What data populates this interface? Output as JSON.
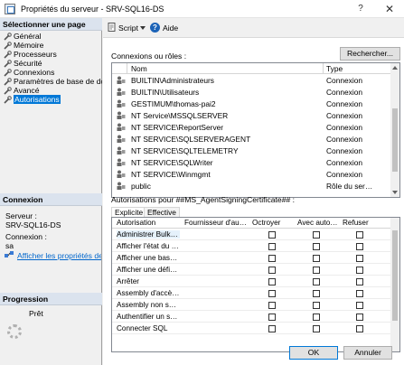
{
  "window": {
    "title": "Propriétés du serveur - SRV-SQL16-DS",
    "help_glyph": "?",
    "close_glyph": "✕"
  },
  "left": {
    "select_page_header": "Sélectionner une page",
    "pages": [
      {
        "label": "Général",
        "selected": false
      },
      {
        "label": "Mémoire",
        "selected": false
      },
      {
        "label": "Processeurs",
        "selected": false
      },
      {
        "label": "Sécurité",
        "selected": false
      },
      {
        "label": "Connexions",
        "selected": false
      },
      {
        "label": "Paramètres de base de données",
        "selected": false
      },
      {
        "label": "Avancé",
        "selected": false
      },
      {
        "label": "Autorisations",
        "selected": true
      }
    ],
    "connection_header": "Connexion",
    "server_label": "Serveur :",
    "server_value": "SRV-SQL16-DS",
    "login_label": "Connexion :",
    "login_value": "sa",
    "view_props_link": "Afficher les propriétés de connexion",
    "progress_header": "Progression",
    "progress_status": "Prêt"
  },
  "toolbar": {
    "script_label": "Script",
    "help_label": "Aide"
  },
  "main": {
    "search_button": "Rechercher...",
    "logins_label": "Connexions ou rôles :",
    "logins_columns": {
      "name": "Nom",
      "type": "Type"
    },
    "logins": [
      {
        "name": "BUILTIN\\Administrateurs",
        "type": "Connexion"
      },
      {
        "name": "BUILTIN\\Utilisateurs",
        "type": "Connexion"
      },
      {
        "name": "GESTIMUM\\thomas-pai2",
        "type": "Connexion"
      },
      {
        "name": "NT Service\\MSSQLSERVER",
        "type": "Connexion"
      },
      {
        "name": "NT SERVICE\\ReportServer",
        "type": "Connexion"
      },
      {
        "name": "NT SERVICE\\SQLSERVERAGENT",
        "type": "Connexion"
      },
      {
        "name": "NT SERVICE\\SQLTELEMETRY",
        "type": "Connexion"
      },
      {
        "name": "NT SERVICE\\SQLWriter",
        "type": "Connexion"
      },
      {
        "name": "NT SERVICE\\Winmgmt",
        "type": "Connexion"
      },
      {
        "name": "public",
        "type": "Rôle du serveur"
      }
    ],
    "permissions_label": "Autorisations pour ##MS_AgentSigningCertificate## :",
    "tabs": [
      "Explicite",
      "Effective"
    ],
    "perm_columns": {
      "permission": "Autorisation",
      "grantor": "Fournisseur d'autori...",
      "grant": "Octroyer",
      "with_grant": "Avec autori...",
      "deny": "Refuser"
    },
    "permissions": [
      "Administrer Bulk O...",
      "Afficher l'état du se...",
      "Afficher une base ...",
      "Afficher une définiti...",
      "Arrêter",
      "Assembly d'accès ...",
      "Assembly non sécu...",
      "Authentifier un serv...",
      "Connecter SQL"
    ]
  },
  "footer": {
    "ok": "OK",
    "cancel": "Annuler"
  }
}
